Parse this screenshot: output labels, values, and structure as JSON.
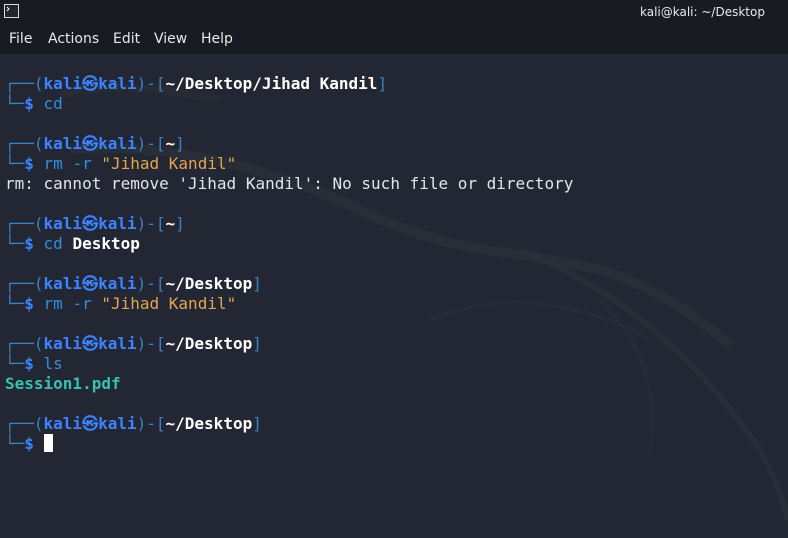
{
  "titlebar": {
    "app_icon": "terminal-icon",
    "title": "kali@kali: ~/Desktop"
  },
  "menu": [
    "File",
    "Actions",
    "Edit",
    "View",
    "Help"
  ],
  "prompt": {
    "open": "┌──(",
    "user": "kali",
    "skull": "㉿",
    "host": "kali",
    "mid": ")-[",
    "close": "]",
    "second": "└─",
    "dollar": "$"
  },
  "terminal": {
    "blocks": [
      {
        "path": "~/Desktop/Jihad Kandil",
        "command": "cd",
        "args": "",
        "string_arg": "",
        "output": ""
      },
      {
        "path": "~",
        "command": "rm -r",
        "args": "",
        "string_arg": "\"Jihad Kandil\"",
        "output": "rm: cannot remove 'Jihad Kandil': No such file or directory"
      },
      {
        "path": "~",
        "command": "cd",
        "args": "Desktop",
        "string_arg": "",
        "output": ""
      },
      {
        "path": "~/Desktop",
        "command": "rm -r",
        "args": "",
        "string_arg": "\"Jihad Kandil\"",
        "output": ""
      },
      {
        "path": "~/Desktop",
        "command": "ls",
        "args": "",
        "string_arg": "",
        "output": "Session1.pdf"
      },
      {
        "path": "~/Desktop",
        "command": "",
        "args": "",
        "string_arg": "",
        "output": ""
      }
    ]
  },
  "colors": {
    "background": "#222733",
    "prompt_blue": "#3d83ff",
    "string_orange": "#e2a550",
    "file_teal": "#37c2b0"
  }
}
